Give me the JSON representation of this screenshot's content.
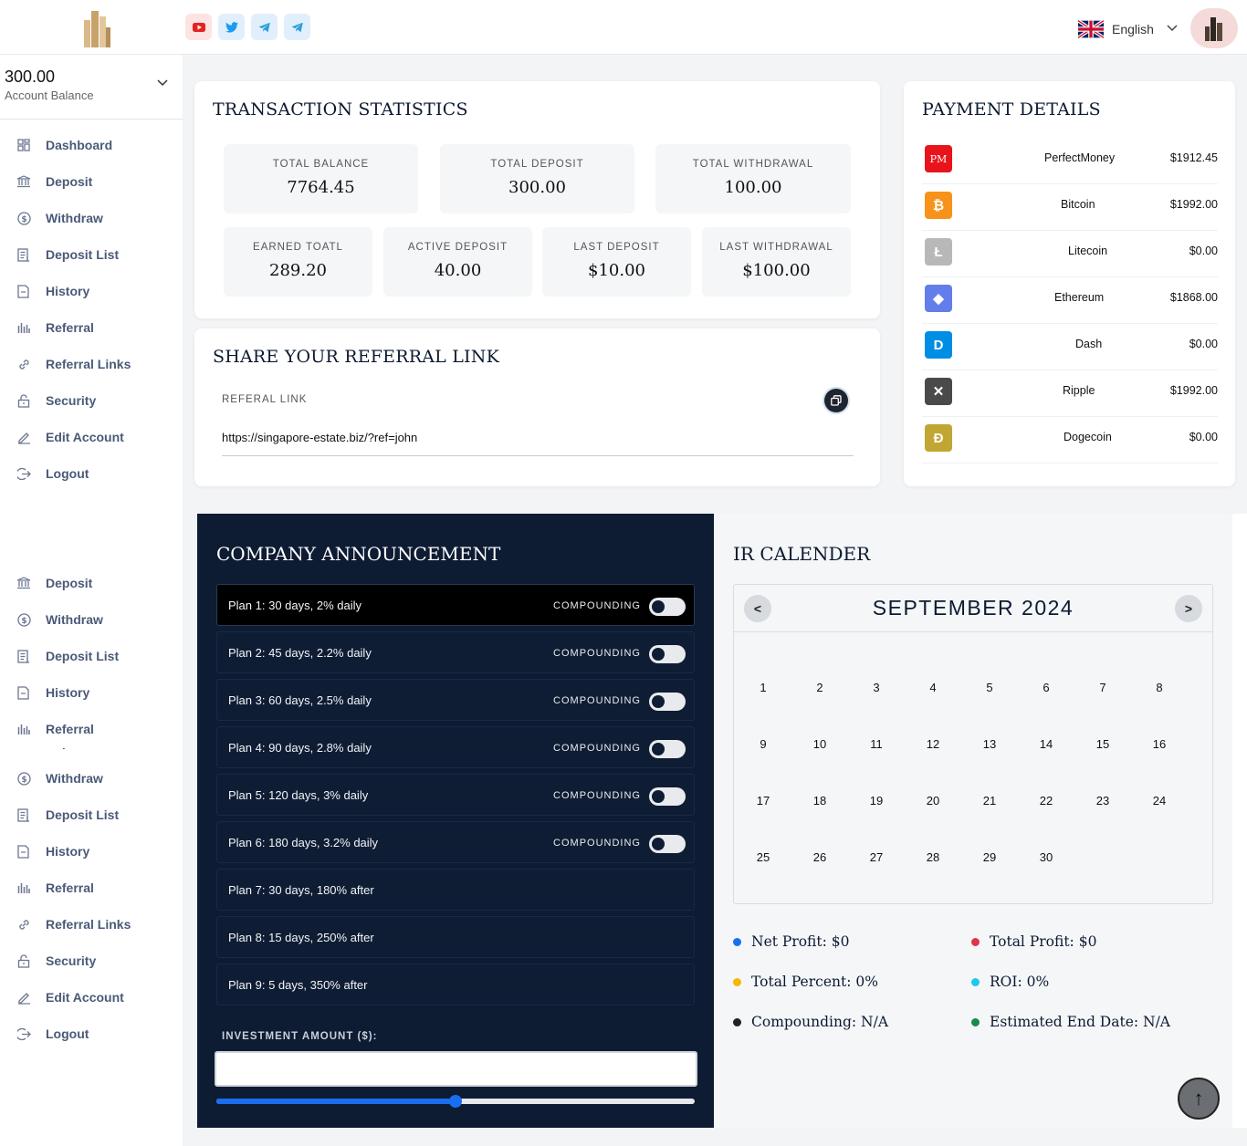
{
  "header": {
    "social": [
      {
        "name": "youtube-icon",
        "bg": "#fde3e3",
        "color": "#e52222"
      },
      {
        "name": "twitter-icon",
        "bg": "#e1effc",
        "color": "#1d9bf0"
      },
      {
        "name": "telegram-icon",
        "bg": "#e1effc",
        "color": "#2a9fd8"
      },
      {
        "name": "telegram-icon",
        "bg": "#e1effc",
        "color": "#2a9fd8"
      }
    ],
    "language": "English"
  },
  "sidebar": {
    "balance": "300.00",
    "balance_label": "Account Balance",
    "nav_main": [
      {
        "label": "Dashboard",
        "icon": "dashboard-icon"
      },
      {
        "label": "Deposit",
        "icon": "bank-icon"
      },
      {
        "label": "Withdraw",
        "icon": "dollar-circle-icon"
      },
      {
        "label": "Deposit List",
        "icon": "list-doc-icon"
      },
      {
        "label": "History",
        "icon": "history-doc-icon"
      },
      {
        "label": "Referral",
        "icon": "bar-chart-icon"
      },
      {
        "label": "Referral Links",
        "icon": "link-icon"
      },
      {
        "label": "Security",
        "icon": "lock-icon"
      },
      {
        "label": "Edit Account",
        "icon": "pencil-icon"
      },
      {
        "label": "Logout",
        "icon": "logout-icon"
      }
    ],
    "nav_dup1": [
      {
        "label": "Deposit",
        "icon": "bank-icon"
      },
      {
        "label": "Withdraw",
        "icon": "dollar-circle-icon"
      },
      {
        "label": "Deposit List",
        "icon": "list-doc-icon"
      },
      {
        "label": "History",
        "icon": "history-doc-icon"
      },
      {
        "label": "Referral",
        "icon": "bar-chart-icon"
      }
    ],
    "nav_dup2": [
      {
        "label": "Deposit",
        "icon": "bank-icon"
      },
      {
        "label": "Withdraw",
        "icon": "dollar-circle-icon"
      },
      {
        "label": "Deposit List",
        "icon": "list-doc-icon"
      },
      {
        "label": "History",
        "icon": "history-doc-icon"
      },
      {
        "label": "Referral",
        "icon": "bar-chart-icon"
      },
      {
        "label": "Referral Links",
        "icon": "link-icon"
      },
      {
        "label": "Security",
        "icon": "lock-icon"
      },
      {
        "label": "Edit Account",
        "icon": "pencil-icon"
      },
      {
        "label": "Logout",
        "icon": "logout-icon"
      }
    ]
  },
  "transaction_stats": {
    "title": "TRANSACTION STATISTICS",
    "row1": [
      {
        "label": "TOTAL BALANCE",
        "value": "7764.45"
      },
      {
        "label": "TOTAL DEPOSIT",
        "value": "300.00"
      },
      {
        "label": "TOTAL WITHDRAWAL",
        "value": "100.00"
      }
    ],
    "row2": [
      {
        "label": "EARNED TOATL",
        "value": "289.20"
      },
      {
        "label": "ACTIVE DEPOSIT",
        "value": "40.00"
      },
      {
        "label": "LAST DEPOSIT",
        "value": "$10.00"
      },
      {
        "label": "LAST WITHDRAWAL",
        "value": "$100.00"
      }
    ]
  },
  "referral": {
    "title": "SHARE YOUR REFERRAL LINK",
    "label": "REFERAL LINK",
    "link": "https://singapore-estate.biz/?ref=john"
  },
  "payment": {
    "title": "PAYMENT DETAILS",
    "items": [
      {
        "name": "PerfectMoney",
        "amount": "$1912.45",
        "icon": "perfectmoney-icon",
        "glyph": "PM",
        "color": "#e8141b"
      },
      {
        "name": "Bitcoin",
        "amount": "$1992.00",
        "icon": "bitcoin-icon",
        "glyph": "₿",
        "color": "#f7931a"
      },
      {
        "name": "Litecoin",
        "amount": "$0.00",
        "icon": "litecoin-icon",
        "glyph": "Ł",
        "color": "#b8b8b8"
      },
      {
        "name": "Ethereum",
        "amount": "$1868.00",
        "icon": "ethereum-icon",
        "glyph": "◆",
        "color": "#627eea"
      },
      {
        "name": "Dash",
        "amount": "$0.00",
        "icon": "dash-icon",
        "glyph": "D",
        "color": "#008de4"
      },
      {
        "name": "Ripple",
        "amount": "$1992.00",
        "icon": "ripple-icon",
        "glyph": "✕",
        "color": "#4a4a4a"
      },
      {
        "name": "Dogecoin",
        "amount": "$0.00",
        "icon": "dogecoin-icon",
        "glyph": "Ð",
        "color": "#c2a633"
      }
    ]
  },
  "announcement": {
    "title": "COMPANY ANNOUNCEMENT",
    "compounding_label": "COMPOUNDING",
    "plans": [
      {
        "text": "Plan 1: 30 days, 2% daily",
        "compounding": true
      },
      {
        "text": "Plan 2: 45 days, 2.2% daily",
        "compounding": true
      },
      {
        "text": "Plan 3: 60 days, 2.5% daily",
        "compounding": true
      },
      {
        "text": "Plan 4: 90 days, 2.8% daily",
        "compounding": true
      },
      {
        "text": "Plan 5: 120 days, 3% daily",
        "compounding": true
      },
      {
        "text": "Plan 6: 180 days, 3.2% daily",
        "compounding": true
      },
      {
        "text": "Plan 7: 30 days, 180% after",
        "compounding": false
      },
      {
        "text": "Plan 8: 15 days, 250% after",
        "compounding": false
      },
      {
        "text": "Plan 9: 5 days, 350% after",
        "compounding": false
      }
    ],
    "investment_label": "INVESTMENT AMOUNT ($):",
    "investment_value": "",
    "slider_fraction": 0.5
  },
  "calendar": {
    "title": "IR CALENDER",
    "month": "SEPTEMBER 2024",
    "prev": "<",
    "next": ">",
    "days": [
      "1",
      "2",
      "3",
      "4",
      "5",
      "6",
      "7",
      "8",
      "9",
      "10",
      "11",
      "12",
      "13",
      "14",
      "15",
      "16",
      "17",
      "18",
      "19",
      "20",
      "21",
      "22",
      "23",
      "24",
      "25",
      "26",
      "27",
      "28",
      "29",
      "30"
    ],
    "legend": [
      {
        "text": "Net Profit: $0",
        "color": "#1a6ef0"
      },
      {
        "text": "Total Profit: $0",
        "color": "#e0334a"
      },
      {
        "text": "Total Percent: 0%",
        "color": "#f5b800"
      },
      {
        "text": "ROI: 0%",
        "color": "#1ec8e8"
      },
      {
        "text": "Compounding: N/A",
        "color": "#222222"
      },
      {
        "text": "Estimated End Date: N/A",
        "color": "#1a8a4a"
      }
    ]
  },
  "scroll_top": "↑"
}
